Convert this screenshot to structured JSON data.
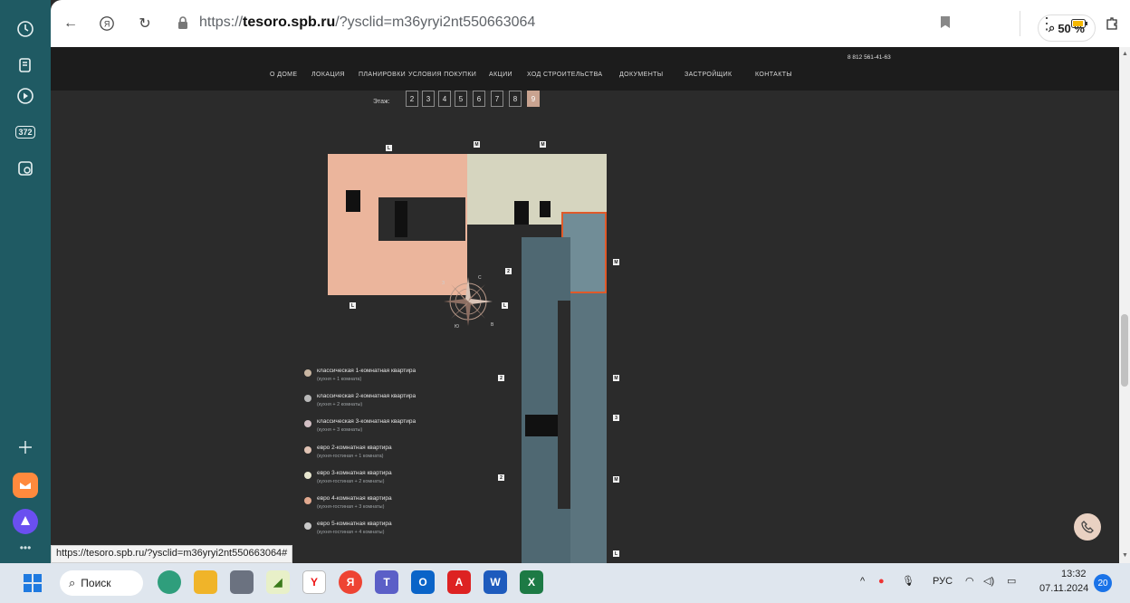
{
  "browser": {
    "url_domain": "tesoro.spb.ru",
    "url_rest": "/?ysclid=m36yryi2nt550663064",
    "url_prefix": "https://",
    "zoom": "50 %",
    "status_url": "https://tesoro.spb.ru/?ysclid=m36yryi2nt550663064#"
  },
  "sidebar": {
    "badge": "372"
  },
  "site": {
    "phone": "8 812 561-41-63",
    "nav": [
      "О ДОМЕ",
      "ЛОКАЦИЯ",
      "ПЛАНИРОВКИ",
      "УСЛОВИЯ ПОКУПКИ",
      "АКЦИИ",
      "ХОД СТРОИТЕЛЬСТВА",
      "ДОКУМЕНТЫ",
      "ЗАСТРОЙЩИК",
      "КОНТАКТЫ"
    ],
    "floor_label": "Этаж:",
    "floors": [
      "2",
      "3",
      "4",
      "5",
      "6",
      "7",
      "8",
      "9"
    ],
    "active_floor": "9",
    "markers": [
      "L",
      "M",
      "M",
      "M",
      "2",
      "L",
      "L",
      "2",
      "M",
      "3",
      "2",
      "M",
      "L"
    ],
    "compass": {
      "n": "С",
      "s": "Ю",
      "e": "В",
      "w": "З"
    }
  },
  "legend": [
    {
      "title": "классическая 1-комнатная квартира",
      "sub": "(кухня + 1 комната)",
      "color": "#c9b6a2"
    },
    {
      "title": "классическая 2-комнатная квартира",
      "sub": "(кухня + 2 комнаты)",
      "color": "#b8b8b8"
    },
    {
      "title": "классическая 3-комнатная квартира",
      "sub": "(кухня + 3 комнаты)",
      "color": "#d3c0c5"
    },
    {
      "title": "евро 2-комнатная квартира",
      "sub": "(кухня-гостиная + 1 комната)",
      "color": "#e0c3b4"
    },
    {
      "title": "евро 3-комнатная квартира",
      "sub": "(кухня-гостиная + 2 комнаты)",
      "color": "#e7e6cf"
    },
    {
      "title": "евро 4-комнатная квартира",
      "sub": "(кухня-гостиная + 3 комнаты)",
      "color": "#e2a98f"
    },
    {
      "title": "евро 5-комнатная квартира",
      "sub": "(кухня-гостиная + 4 комнаты)",
      "color": "#c9c9c9"
    }
  ],
  "taskbar": {
    "search_label": "Поиск",
    "lang": "РУС",
    "time": "13:32",
    "date": "07.11.2024",
    "notif_count": "20"
  }
}
